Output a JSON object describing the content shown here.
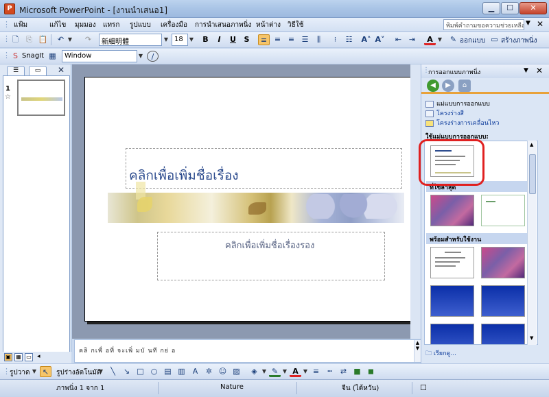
{
  "window": {
    "title": "Microsoft PowerPoint - [งานนำเสนอ1]",
    "app_icon_label": "P",
    "minimize": "▁",
    "maximize": "☐",
    "close": "✕"
  },
  "menu": {
    "items": [
      "แฟ้ม",
      "แก้ไข",
      "มุมมอง",
      "แทรก",
      "รูปแบบ",
      "เครื่องมือ",
      "การนำเสนอภาพนิ่ง",
      "หน้าต่าง",
      "วิธีใช้"
    ],
    "help_placeholder": "พิมพ์คำถามขอความช่วยเหลือ",
    "close_doc": "✕"
  },
  "format_toolbar": {
    "font": "新細明體",
    "size": "18",
    "bold": "B",
    "italic": "I",
    "underline": "U",
    "shadow": "S",
    "design_label": "ออกแบบ",
    "new_slide_label": "สร้างภาพนิ่ง"
  },
  "snagit_toolbar": {
    "snagit_label": "SnagIt",
    "window_value": "Window"
  },
  "left_pane": {
    "slide_number": "1",
    "star": "☆",
    "close": "✕"
  },
  "slide": {
    "title_placeholder": "คลิกเพื่อเพิ่มชื่อเรื่อง",
    "subtitle_placeholder": "คลิกเพื่อเพิ่มชื่อเรื่องรอง"
  },
  "notes": {
    "placeholder": "คลิ กเพื่ อที่ จะเพิ่ มบั นที กย่ อ"
  },
  "task_pane": {
    "title": "การออกแบบภาพนิ่ง",
    "links": [
      "แม่แบบการออกแบบ",
      "โครงร่างสี",
      "โครงร่างการเคลื่อนไหว"
    ],
    "apply_label": "ใช้แม่แบบการออกแบบ:",
    "section_recent": "ที่ใช้ล่าสุด",
    "section_available": "พร้อมสำหรับใช้งาน",
    "more_label": "เรียกดู...",
    "close": "✕"
  },
  "drawing_toolbar": {
    "draw_label": "รูปวาด",
    "autoshapes_label": "รูปร่างอัตโนมัติ"
  },
  "status": {
    "slide_position": "ภาพนิ่ง 1 จาก 1",
    "design_name": "Nature",
    "language": "จีน (ไต้หวัน)"
  },
  "colors": {
    "accent_orange": "#e8a23a",
    "highlight_red": "#e02020",
    "title_text": "#2d4c8e"
  }
}
